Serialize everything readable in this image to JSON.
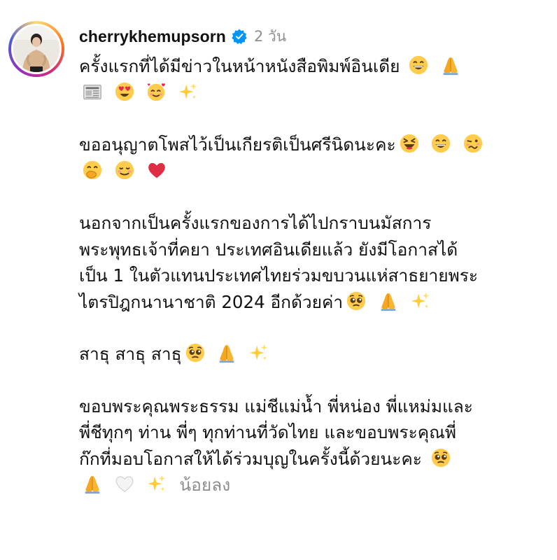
{
  "post": {
    "username": "cherrykhemupsorn",
    "verified": true,
    "timestamp": "2 วัน",
    "caption": {
      "p1_l1": "ครั้งแรกที่ได้มีข่าวในหน้าหนังสือพิมพ์อินเดีย",
      "p2_l1": "ขออนุญาตโพสไว้เป็นเกียรติเป็นศรีนิดนะคะ",
      "p3_l1": "นอกจากเป็นครั้งแรกของการได้ไปกราบนมัสการ",
      "p3_l2": "พระพุทธเจ้าที่คยา ประเทศอินเดียแล้ว ยังมีโอกาสได้",
      "p3_l3": "เป็น 1 ในตัวแทนประเทศไทยร่วมขบวนแห่สาธยายพระ",
      "p3_l4": "ไตรปิฎกนานาชาติ 2024 อีกด้วยค่า",
      "p4_l1": "สาธุ สาธุ สาธุ",
      "p5_l1": "ขอบพระคุณพระธรรม แม่ชีแม่น้ำ พี่หน่อง พี่แหม่มและ",
      "p5_l2": "พี่ชีทุกๆ ท่าน พี่ๆ ทุกท่านที่วัดไทย และขอบพระคุณพี่",
      "p5_l3": "ก๊กที่มอบโอกาสให้ได้ร่วมบุญในครั้งนี้ด้วยนะคะ"
    },
    "see_less_label": "น้อยลง"
  },
  "emoji": {
    "p1": [
      "grinning-face-icon",
      "folded-hands-icon",
      "newspaper-icon",
      "heart-eyes-face-icon",
      "smiling-face-with-hearts-icon",
      "sparkles-icon"
    ],
    "p2": [
      "laughing-face-icon",
      "grinning-face-icon",
      "woozy-face-icon",
      "hand-over-mouth-face-icon",
      "blushing-face-icon",
      "red-heart-icon"
    ],
    "p3": [
      "pleading-face-icon",
      "folded-hands-icon",
      "sparkles-icon"
    ],
    "p4": [
      "pleading-face-icon",
      "folded-hands-icon",
      "sparkles-icon"
    ],
    "p5": [
      "pleading-face-icon",
      "folded-hands-icon",
      "white-heart-icon",
      "sparkles-icon"
    ]
  },
  "colors": {
    "verified_badge": "#0095f6",
    "timestamp": "#8e8e8e",
    "see_less": "#8e8e8e",
    "text": "#111111"
  }
}
